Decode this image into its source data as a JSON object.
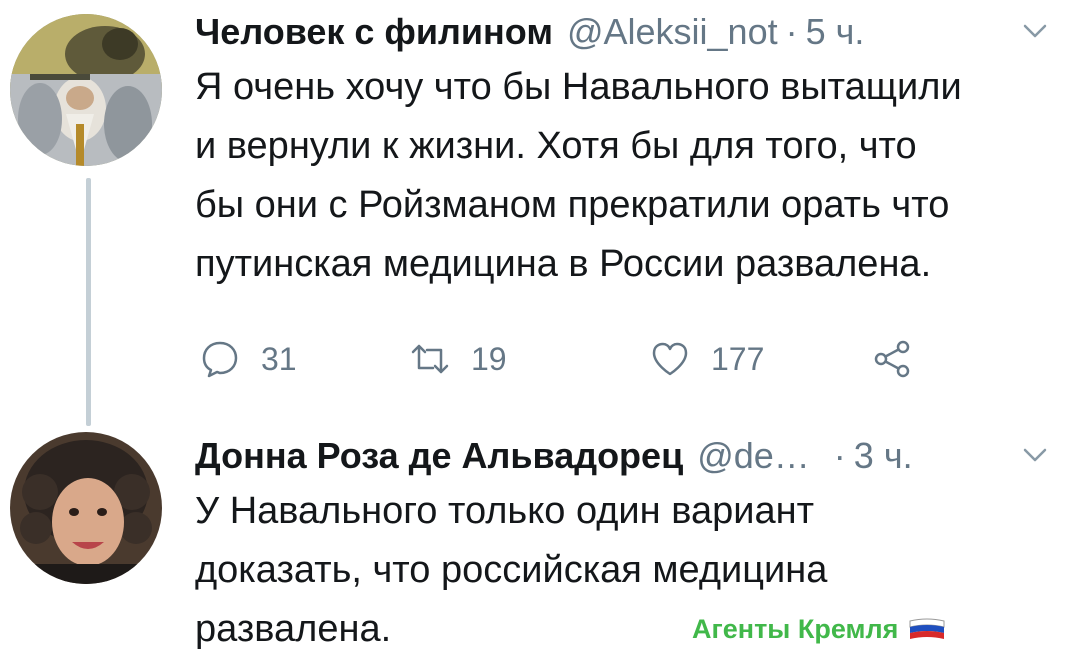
{
  "tweets": [
    {
      "display_name": "Человек с филином",
      "handle": "@Aleksii_not",
      "separator": "·",
      "time": "5 ч.",
      "text": "Я очень хочу что бы Навального вытащили\nи вернули к жизни. Хотя бы для того, что\nбы они с Ройзманом прекратили орать что\nпутинская медицина в России развалена.",
      "actions": {
        "replies": "31",
        "retweets": "19",
        "likes": "177"
      }
    },
    {
      "display_name": "Донна Роза де Альвадорец",
      "handle": "@de…",
      "separator": "·",
      "time": "3 ч.",
      "text": "У Навального только один вариант\nдоказать, что российская медицина\nразвалена."
    }
  ],
  "watermark": {
    "text": "Агенты Кремля"
  },
  "colors": {
    "text": "#14171a",
    "secondary": "#657786",
    "thread_line": "#c4cfd6",
    "watermark": "#41b84a"
  },
  "icons": [
    "reply-icon",
    "retweet-icon",
    "like-icon",
    "share-icon",
    "chevron-down-icon",
    "russia-flag-icon"
  ]
}
